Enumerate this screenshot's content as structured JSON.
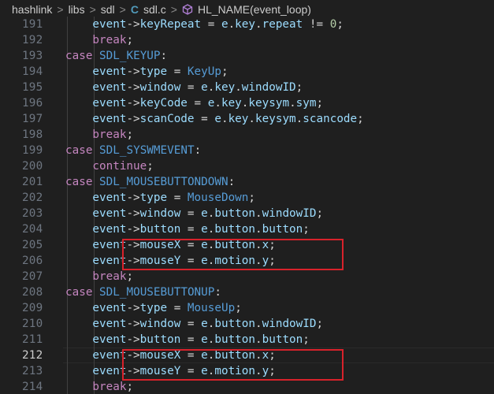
{
  "breadcrumb": {
    "items": [
      "hashlink",
      "libs",
      "sdl",
      "sdl.c",
      "HL_NAME(event_loop)"
    ],
    "separator": ">"
  },
  "colors": {
    "background": "#1f1f1f",
    "highlight_box": "#d8222b",
    "keyword": "#569cd6",
    "control": "#c586c0",
    "variable": "#9cdcfe",
    "number": "#b5cea8"
  },
  "editor": {
    "active_line": 212,
    "lines": [
      {
        "num": "191",
        "indent": 2,
        "tokens": [
          [
            "var",
            "event"
          ],
          [
            "op",
            "->"
          ],
          [
            "var",
            "keyRepeat"
          ],
          [
            "op",
            " = "
          ],
          [
            "var",
            "e"
          ],
          [
            "op",
            "."
          ],
          [
            "var",
            "key"
          ],
          [
            "op",
            "."
          ],
          [
            "var",
            "repeat"
          ],
          [
            "op",
            " != "
          ],
          [
            "num",
            "0"
          ],
          [
            "op",
            ";"
          ]
        ]
      },
      {
        "num": "192",
        "indent": 2,
        "tokens": [
          [
            "ctrl",
            "break"
          ],
          [
            "op",
            ";"
          ]
        ]
      },
      {
        "num": "193",
        "indent": 1,
        "tokens": [
          [
            "ctrl",
            "case"
          ],
          [
            "op",
            " "
          ],
          [
            "const",
            "SDL_KEYUP"
          ],
          [
            "op",
            ":"
          ]
        ]
      },
      {
        "num": "194",
        "indent": 2,
        "tokens": [
          [
            "var",
            "event"
          ],
          [
            "op",
            "->"
          ],
          [
            "var",
            "type"
          ],
          [
            "op",
            " = "
          ],
          [
            "const",
            "KeyUp"
          ],
          [
            "op",
            ";"
          ]
        ]
      },
      {
        "num": "195",
        "indent": 2,
        "tokens": [
          [
            "var",
            "event"
          ],
          [
            "op",
            "->"
          ],
          [
            "var",
            "window"
          ],
          [
            "op",
            " = "
          ],
          [
            "var",
            "e"
          ],
          [
            "op",
            "."
          ],
          [
            "var",
            "key"
          ],
          [
            "op",
            "."
          ],
          [
            "var",
            "windowID"
          ],
          [
            "op",
            ";"
          ]
        ]
      },
      {
        "num": "196",
        "indent": 2,
        "tokens": [
          [
            "var",
            "event"
          ],
          [
            "op",
            "->"
          ],
          [
            "var",
            "keyCode"
          ],
          [
            "op",
            " = "
          ],
          [
            "var",
            "e"
          ],
          [
            "op",
            "."
          ],
          [
            "var",
            "key"
          ],
          [
            "op",
            "."
          ],
          [
            "var",
            "keysym"
          ],
          [
            "op",
            "."
          ],
          [
            "var",
            "sym"
          ],
          [
            "op",
            ";"
          ]
        ]
      },
      {
        "num": "197",
        "indent": 2,
        "tokens": [
          [
            "var",
            "event"
          ],
          [
            "op",
            "->"
          ],
          [
            "var",
            "scanCode"
          ],
          [
            "op",
            " = "
          ],
          [
            "var",
            "e"
          ],
          [
            "op",
            "."
          ],
          [
            "var",
            "key"
          ],
          [
            "op",
            "."
          ],
          [
            "var",
            "keysym"
          ],
          [
            "op",
            "."
          ],
          [
            "var",
            "scancode"
          ],
          [
            "op",
            ";"
          ]
        ]
      },
      {
        "num": "198",
        "indent": 2,
        "tokens": [
          [
            "ctrl",
            "break"
          ],
          [
            "op",
            ";"
          ]
        ]
      },
      {
        "num": "199",
        "indent": 1,
        "tokens": [
          [
            "ctrl",
            "case"
          ],
          [
            "op",
            " "
          ],
          [
            "const",
            "SDL_SYSWMEVENT"
          ],
          [
            "op",
            ":"
          ]
        ]
      },
      {
        "num": "200",
        "indent": 2,
        "tokens": [
          [
            "ctrl",
            "continue"
          ],
          [
            "op",
            ";"
          ]
        ]
      },
      {
        "num": "201",
        "indent": 1,
        "tokens": [
          [
            "ctrl",
            "case"
          ],
          [
            "op",
            " "
          ],
          [
            "const",
            "SDL_MOUSEBUTTONDOWN"
          ],
          [
            "op",
            ":"
          ]
        ]
      },
      {
        "num": "202",
        "indent": 2,
        "tokens": [
          [
            "var",
            "event"
          ],
          [
            "op",
            "->"
          ],
          [
            "var",
            "type"
          ],
          [
            "op",
            " = "
          ],
          [
            "const",
            "MouseDown"
          ],
          [
            "op",
            ";"
          ]
        ]
      },
      {
        "num": "203",
        "indent": 2,
        "tokens": [
          [
            "var",
            "event"
          ],
          [
            "op",
            "->"
          ],
          [
            "var",
            "window"
          ],
          [
            "op",
            " = "
          ],
          [
            "var",
            "e"
          ],
          [
            "op",
            "."
          ],
          [
            "var",
            "button"
          ],
          [
            "op",
            "."
          ],
          [
            "var",
            "windowID"
          ],
          [
            "op",
            ";"
          ]
        ]
      },
      {
        "num": "204",
        "indent": 2,
        "tokens": [
          [
            "var",
            "event"
          ],
          [
            "op",
            "->"
          ],
          [
            "var",
            "button"
          ],
          [
            "op",
            " = "
          ],
          [
            "var",
            "e"
          ],
          [
            "op",
            "."
          ],
          [
            "var",
            "button"
          ],
          [
            "op",
            "."
          ],
          [
            "var",
            "button"
          ],
          [
            "op",
            ";"
          ]
        ]
      },
      {
        "num": "205",
        "indent": 2,
        "tokens": [
          [
            "var",
            "event"
          ],
          [
            "op",
            "->"
          ],
          [
            "var",
            "mouseX"
          ],
          [
            "op",
            " = "
          ],
          [
            "var",
            "e"
          ],
          [
            "op",
            "."
          ],
          [
            "var",
            "button"
          ],
          [
            "op",
            "."
          ],
          [
            "var",
            "x"
          ],
          [
            "op",
            ";"
          ]
        ]
      },
      {
        "num": "206",
        "indent": 2,
        "tokens": [
          [
            "var",
            "event"
          ],
          [
            "op",
            "->"
          ],
          [
            "var",
            "mouseY"
          ],
          [
            "op",
            " = "
          ],
          [
            "var",
            "e"
          ],
          [
            "op",
            "."
          ],
          [
            "var",
            "motion"
          ],
          [
            "op",
            "."
          ],
          [
            "var",
            "y"
          ],
          [
            "op",
            ";"
          ]
        ]
      },
      {
        "num": "207",
        "indent": 2,
        "tokens": [
          [
            "ctrl",
            "break"
          ],
          [
            "op",
            ";"
          ]
        ]
      },
      {
        "num": "208",
        "indent": 1,
        "tokens": [
          [
            "ctrl",
            "case"
          ],
          [
            "op",
            " "
          ],
          [
            "const",
            "SDL_MOUSEBUTTONUP"
          ],
          [
            "op",
            ":"
          ]
        ]
      },
      {
        "num": "209",
        "indent": 2,
        "tokens": [
          [
            "var",
            "event"
          ],
          [
            "op",
            "->"
          ],
          [
            "var",
            "type"
          ],
          [
            "op",
            " = "
          ],
          [
            "const",
            "MouseUp"
          ],
          [
            "op",
            ";"
          ]
        ]
      },
      {
        "num": "210",
        "indent": 2,
        "tokens": [
          [
            "var",
            "event"
          ],
          [
            "op",
            "->"
          ],
          [
            "var",
            "window"
          ],
          [
            "op",
            " = "
          ],
          [
            "var",
            "e"
          ],
          [
            "op",
            "."
          ],
          [
            "var",
            "button"
          ],
          [
            "op",
            "."
          ],
          [
            "var",
            "windowID"
          ],
          [
            "op",
            ";"
          ]
        ]
      },
      {
        "num": "211",
        "indent": 2,
        "tokens": [
          [
            "var",
            "event"
          ],
          [
            "op",
            "->"
          ],
          [
            "var",
            "button"
          ],
          [
            "op",
            " = "
          ],
          [
            "var",
            "e"
          ],
          [
            "op",
            "."
          ],
          [
            "var",
            "button"
          ],
          [
            "op",
            "."
          ],
          [
            "var",
            "button"
          ],
          [
            "op",
            ";"
          ]
        ]
      },
      {
        "num": "212",
        "indent": 2,
        "tokens": [
          [
            "var",
            "event"
          ],
          [
            "op",
            "->"
          ],
          [
            "var",
            "mouseX"
          ],
          [
            "op",
            " = "
          ],
          [
            "var",
            "e"
          ],
          [
            "op",
            "."
          ],
          [
            "var",
            "button"
          ],
          [
            "op",
            "."
          ],
          [
            "var",
            "x"
          ],
          [
            "op",
            ";"
          ]
        ]
      },
      {
        "num": "213",
        "indent": 2,
        "tokens": [
          [
            "var",
            "event"
          ],
          [
            "op",
            "->"
          ],
          [
            "var",
            "mouseY"
          ],
          [
            "op",
            " = "
          ],
          [
            "var",
            "e"
          ],
          [
            "op",
            "."
          ],
          [
            "var",
            "motion"
          ],
          [
            "op",
            "."
          ],
          [
            "var",
            "y"
          ],
          [
            "op",
            ";"
          ]
        ]
      },
      {
        "num": "214",
        "indent": 2,
        "tokens": [
          [
            "ctrl",
            "break"
          ],
          [
            "op",
            ";"
          ]
        ]
      }
    ],
    "highlighted_ranges": [
      [
        "205",
        "206"
      ],
      [
        "212",
        "213"
      ]
    ]
  }
}
